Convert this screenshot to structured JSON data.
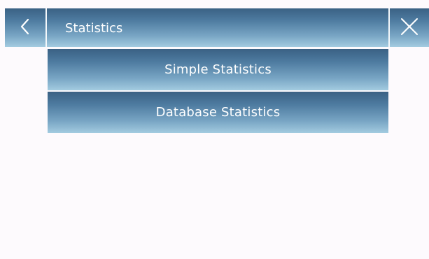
{
  "header": {
    "title": "Statistics",
    "back_icon": "chevron-left-icon",
    "close_icon": "close-icon"
  },
  "menu": {
    "items": [
      {
        "label": "Simple Statistics"
      },
      {
        "label": "Database Statistics"
      }
    ]
  },
  "colors": {
    "background": "#fdfafd",
    "button_gradient_top": "#3a6184",
    "button_gradient_bottom": "#a3cbe0",
    "text": "#ffffff"
  }
}
